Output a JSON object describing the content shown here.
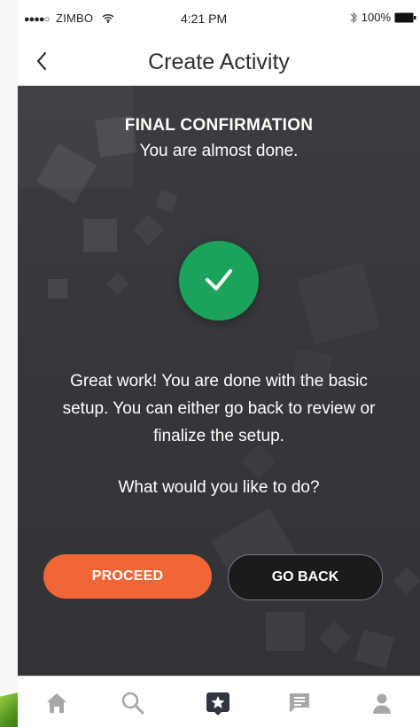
{
  "status_bar": {
    "signal_dots": "●●●●○",
    "carrier": "ZIMBO",
    "time": "4:21 PM",
    "battery": "100%"
  },
  "nav": {
    "title": "Create Activity",
    "back_icon": "chevron-left-icon"
  },
  "main": {
    "title": "FINAL CONFIRMATION",
    "subtitle": "You are almost done.",
    "success_icon": "check-icon",
    "message": "Great work! You are done with the basic setup. You can either go back to review or finalize the setup.",
    "question": "What would you like to do?"
  },
  "actions": {
    "proceed": "PROCEED",
    "go_back": "GO BACK"
  },
  "tabs": [
    {
      "icon": "home-icon",
      "active": false
    },
    {
      "icon": "search-icon",
      "active": false
    },
    {
      "icon": "create-activity-icon",
      "active": true
    },
    {
      "icon": "message-icon",
      "active": false
    },
    {
      "icon": "profile-icon",
      "active": false
    }
  ],
  "colors": {
    "background": "#3a3c40",
    "success": "#1ca35b",
    "proceed": "#f06636",
    "go_back": "#1b1b1d",
    "tab_inactive": "#a7a7a7",
    "tab_active": "#2f3640"
  }
}
